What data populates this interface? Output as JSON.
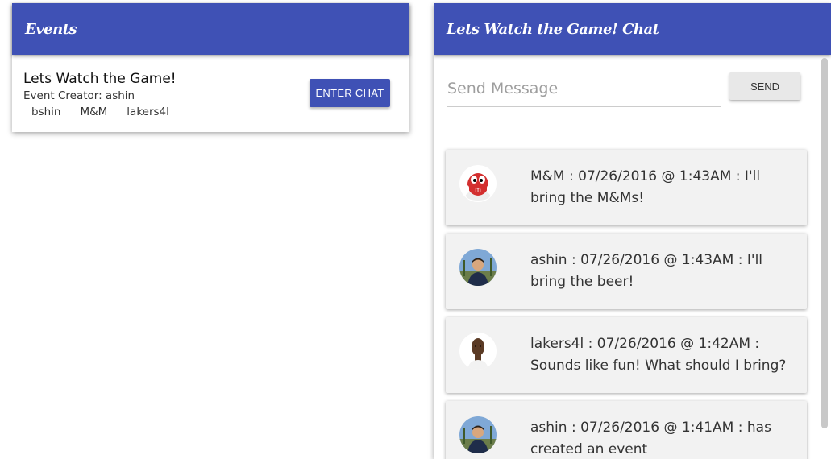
{
  "events_panel": {
    "title": "Events",
    "event": {
      "title": "Lets Watch the Game!",
      "creator": "Event Creator: ashin",
      "members": [
        "bshin",
        "M&M",
        "lakers4l"
      ],
      "enter_label": "ENTER CHAT"
    }
  },
  "chat_panel": {
    "title": "Lets Watch the Game! Chat",
    "input_placeholder": "Send Message",
    "send_label": "SEND",
    "messages": [
      {
        "avatar": "mm-candy-avatar",
        "text": "M&M : 07/26/2016 @ 1:43AM : I'll bring the M&Ms!"
      },
      {
        "avatar": "ashin-avatar",
        "text": "ashin : 07/26/2016 @ 1:43AM : I'll bring the beer!"
      },
      {
        "avatar": "lakers4l-avatar",
        "text": "lakers4l : 07/26/2016 @ 1:42AM : Sounds like fun! What should I bring?"
      },
      {
        "avatar": "ashin-avatar",
        "text": "ashin : 07/26/2016 @ 1:41AM : has created an event"
      }
    ]
  },
  "colors": {
    "primary": "#3f51b5",
    "card_bg": "#f2f2f2"
  }
}
